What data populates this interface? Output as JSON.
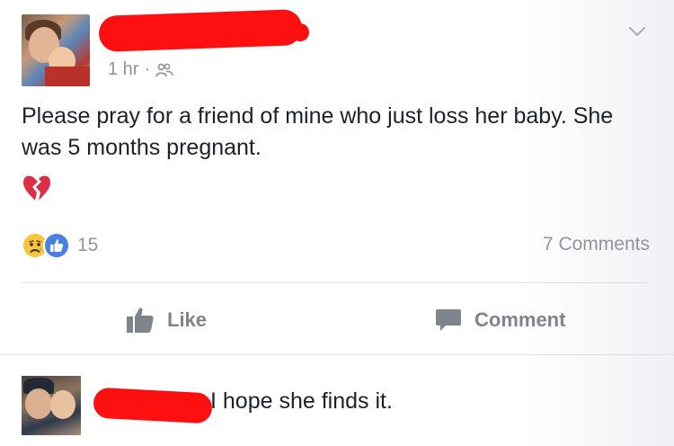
{
  "post": {
    "timestamp": "1 hr",
    "separator": "·",
    "audience_icon": "friends-icon",
    "text": "Please pray for a friend of mine who just loss her baby. She was 5 months pregnant.",
    "emoji": "broken-heart-icon",
    "reaction_count": "15",
    "comments_label": "7 Comments"
  },
  "actions": {
    "like_label": "Like",
    "comment_label": "Comment"
  },
  "comment": {
    "text": "I hope she finds it."
  },
  "colors": {
    "redaction": "#ff1010",
    "like_blue": "#4a7fe4",
    "sad_yellow": "#f7c53f",
    "meta_gray": "#90949c",
    "heart_red": "#dd2e44"
  }
}
